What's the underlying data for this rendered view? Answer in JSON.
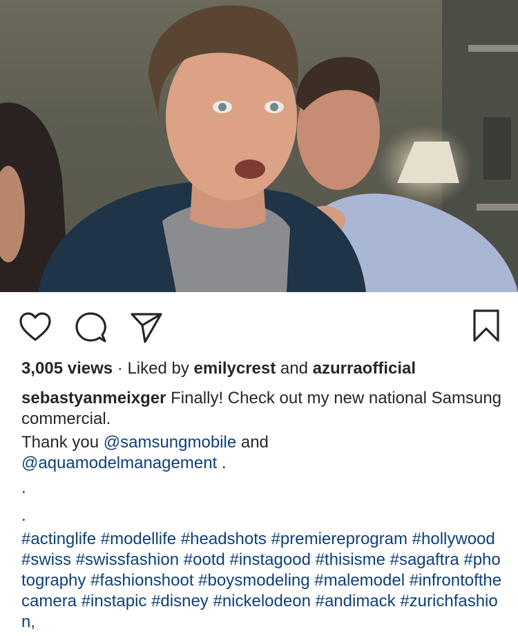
{
  "media": {
    "description_icon": "video-still-image"
  },
  "actions": {
    "like_icon": "heart-outline-icon",
    "comment_icon": "comment-bubble-icon",
    "share_icon": "paper-plane-icon",
    "save_icon": "bookmark-icon"
  },
  "stats": {
    "views": "3,005 views",
    "liked_by_prefix": " · Liked by ",
    "liker1": "emilycrest",
    "and": " and ",
    "liker2": "azurraofficial"
  },
  "caption": {
    "username": "sebastyanmeixger",
    "text1": " Finally! Check out my new national Samsung commercial.",
    "thanks": "Thank you ",
    "mention1": "@samsungmobile",
    "and_text": " and",
    "mention2": "@aquamodelmanagement",
    "after_mention2": " .",
    "dot1": ".",
    "dot2": ".",
    "hashtags": "#actinglife #modellife #headshots #premiereprogram #hollywood #swiss #swissfashion #ootd #instagood #thisisme #sagaftra #photography #fashionshoot #boysmodeling #malemodel #infrontofthecamera #instapic #disney #nickelodeon #andimack #zurichfashion,"
  },
  "colors": {
    "link": "#0f3f79",
    "text": "#262626"
  }
}
